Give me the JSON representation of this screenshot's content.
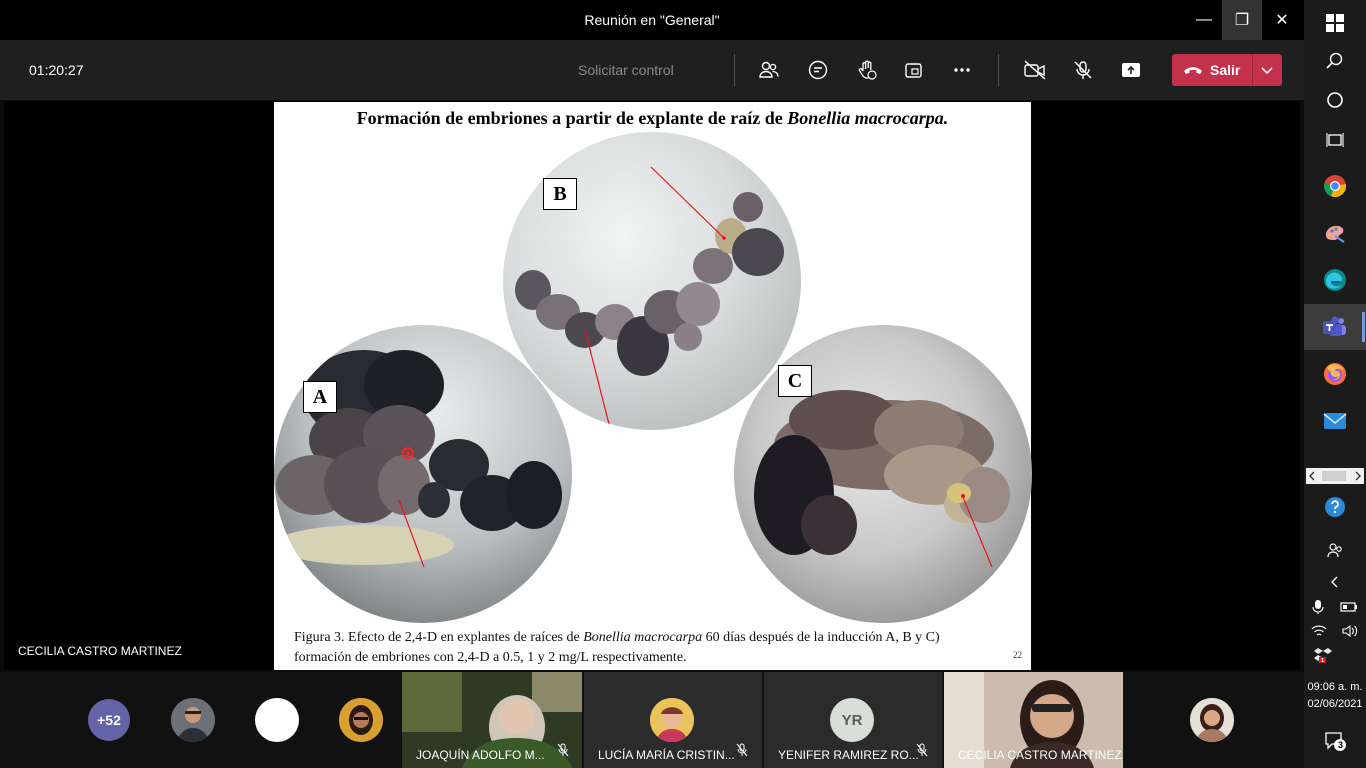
{
  "window": {
    "title": "Reunión en \"General\"",
    "minimize_glyph": "—",
    "maximize_glyph": "❐",
    "close_glyph": "✕"
  },
  "toolbar": {
    "timer": "01:20:27",
    "request_control": "Solicitar control",
    "icons": [
      "participants-icon",
      "chat-icon",
      "raise-hand-icon",
      "share-tray-icon",
      "more-options-icon",
      "camera-off-icon",
      "mic-off-icon",
      "share-content-icon"
    ],
    "leave_label": "Salir",
    "leave_color": "#c4314b"
  },
  "slide": {
    "title_prefix": "Formación de embriones a partir de explante de raíz  de ",
    "title_italic": "Bonellia macrocarpa.",
    "labels": {
      "a": "A",
      "b": "B",
      "c": "C"
    },
    "caption_part1": "Figura 3. Efecto de 2,4-D en explantes de raíces de ",
    "caption_italic": "Bonellia macrocarpa",
    "caption_part2": " 60 días después de la inducción A, B y C) formación de embriones con 2,4-D a 0.5, 1 y 2 mg/L respectivamente.",
    "page_number": "22"
  },
  "presenter": {
    "name": "CECILIA CASTRO MARTINEZ"
  },
  "participants": {
    "overflow_count": "+52",
    "overflow_color": "#6264a7",
    "initials_avatar": "YR",
    "tiles": [
      {
        "name": "JOAQUÍN ADOLFO M..."
      },
      {
        "name": "LUCÍA MARÍA CRISTIN..."
      },
      {
        "name": "YENIFER RAMIREZ RO..."
      },
      {
        "name": "CECILIA CASTRO MARTINEZ"
      }
    ]
  },
  "taskbar": {
    "apps": [
      "windows-start-icon",
      "search-icon",
      "cortana-icon",
      "task-view-icon",
      "chrome-icon",
      "paint-icon",
      "edge-icon",
      "teams-icon",
      "firefox-icon",
      "mail-icon"
    ],
    "time": "09:06 a. m.",
    "date": "02/06/2021",
    "notification_count": "3"
  }
}
